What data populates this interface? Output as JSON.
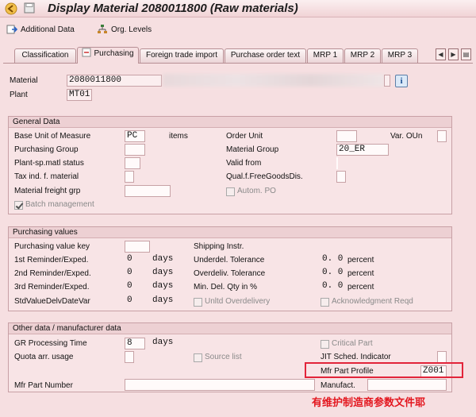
{
  "window": {
    "title": "Display Material 2080011800 (Raw materials)"
  },
  "toolbar": {
    "additional_data": "Additional Data",
    "org_levels": "Org. Levels"
  },
  "tabs": [
    {
      "label": "Classification"
    },
    {
      "label": "Purchasing"
    },
    {
      "label": "Foreign trade import"
    },
    {
      "label": "Purchase order text"
    },
    {
      "label": "MRP 1"
    },
    {
      "label": "MRP 2"
    },
    {
      "label": "MRP 3"
    }
  ],
  "header": {
    "material_label": "Material",
    "material_value": "2080011800",
    "plant_label": "Plant",
    "plant_value": "MT01"
  },
  "general": {
    "title": "General Data",
    "base_uom_label": "Base Unit of Measure",
    "base_uom_value": "PC",
    "base_uom_text": "items",
    "order_unit_label": "Order Unit",
    "var_oun_label": "Var. OUn",
    "purch_group_label": "Purchasing Group",
    "material_group_label": "Material Group",
    "material_group_value": "20_ER",
    "plant_matl_status_label": "Plant-sp.matl status",
    "valid_from_label": "Valid from",
    "tax_ind_label": "Tax ind. f. material",
    "qual_free_goods_label": "Qual.f.FreeGoodsDis.",
    "freight_grp_label": "Material freight grp",
    "autom_po_label": "Autom. PO",
    "batch_mgmt_label": "Batch management"
  },
  "purchasing": {
    "title": "Purchasing values",
    "pv_key_label": "Purchasing value key",
    "shipping_instr_label": "Shipping Instr.",
    "rem1_label": "1st Reminder/Exped.",
    "rem1_value": "0",
    "rem1_unit": "days",
    "underdel_label": "Underdel. Tolerance",
    "underdel_value": "0. 0",
    "underdel_unit": "percent",
    "rem2_label": "2nd Reminder/Exped.",
    "rem2_value": "0",
    "rem2_unit": "days",
    "overdel_label": "Overdeliv. Tolerance",
    "overdel_value": "0. 0",
    "overdel_unit": "percent",
    "rem3_label": "3rd Reminder/Exped.",
    "rem3_value": "0",
    "rem3_unit": "days",
    "min_del_label": "Min. Del. Qty in %",
    "min_del_value": "0. 0",
    "min_del_unit": "percent",
    "std_value_label": "StdValueDelvDateVar",
    "std_value_value": "0",
    "std_value_unit": "days",
    "unltd_label": "Unltd Overdelivery",
    "ack_label": "Acknowledgment Reqd"
  },
  "other": {
    "title": "Other data / manufacturer data",
    "gr_time_label": "GR Processing Time",
    "gr_time_value": "8",
    "gr_time_unit": "days",
    "critical_part_label": "Critical Part",
    "quota_label": "Quota arr. usage",
    "source_list_label": "Source list",
    "jit_label": "JIT Sched. Indicator",
    "mfr_profile_label": "Mfr Part Profile",
    "mfr_profile_value": "Z001",
    "mfr_part_no_label": "Mfr Part Number",
    "manufact_label": "Manufact."
  },
  "annotation": "有维护制造商参数文件耶",
  "colors": {
    "annotation": "#e3171f",
    "highlight_box": "#e2243a",
    "background": "#f6dfe1"
  }
}
